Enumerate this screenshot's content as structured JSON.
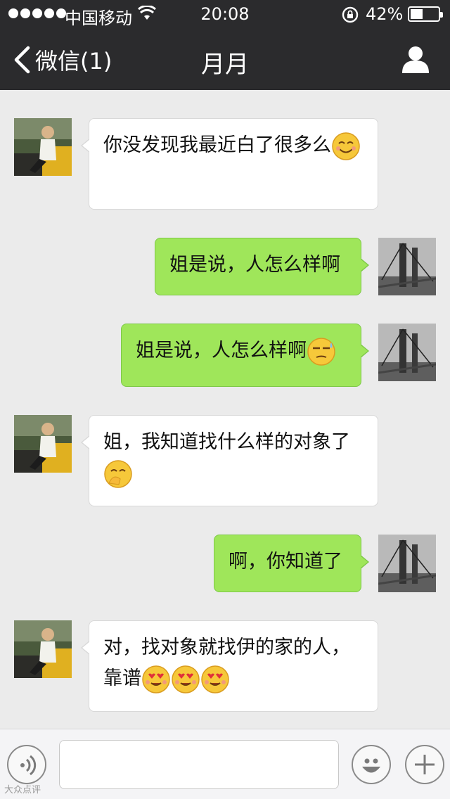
{
  "status_bar": {
    "carrier": "中国移动",
    "time": "20:08",
    "battery_text": "42%",
    "battery_level": 0.42,
    "signal_dots": 5
  },
  "nav": {
    "back_label": "微信(1)",
    "title": "月月",
    "profile_icon": "person-icon"
  },
  "messages": [
    {
      "side": "in",
      "text": "你没发现我最近白了很多么",
      "emoji": [
        "smile"
      ]
    },
    {
      "side": "out",
      "text": "姐是说，人怎么样啊",
      "emoji": []
    },
    {
      "side": "out",
      "text": "姐是说，人怎么样啊",
      "emoji": [
        "sweat"
      ]
    },
    {
      "side": "in",
      "text": "姐，我知道找什么样的对象了",
      "emoji": [
        "giggle"
      ]
    },
    {
      "side": "out",
      "text": "啊，你知道了",
      "emoji": []
    },
    {
      "side": "in",
      "text": "对，找对象就找伊的家的人，靠谱",
      "emoji": [
        "heart-eyes",
        "heart-eyes",
        "heart-eyes"
      ]
    }
  ],
  "input_bar": {
    "voice_icon": "voice-icon",
    "input_value": "",
    "emoji_icon": "emoji-icon",
    "plus_icon": "plus-icon"
  },
  "watermark": "大众点评",
  "colors": {
    "bar": "#2b2b2d",
    "background": "#ebebeb",
    "outgoing_bubble": "#9fe65a",
    "incoming_bubble": "#ffffff"
  }
}
